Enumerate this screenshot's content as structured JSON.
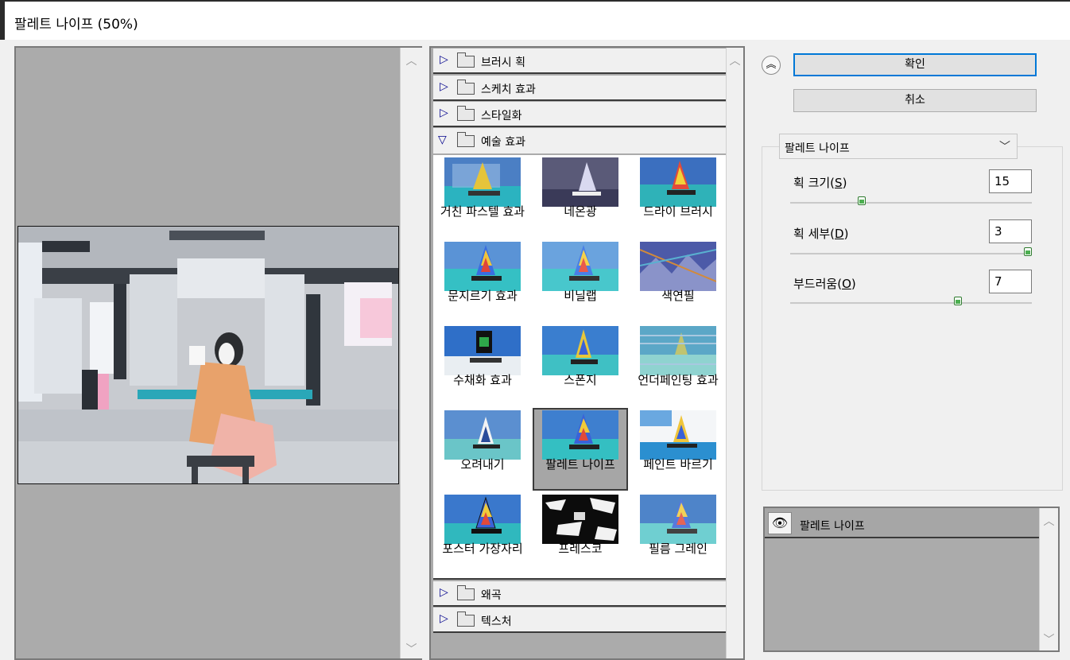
{
  "window": {
    "title": "팔레트 나이프 (50%)"
  },
  "gallery": {
    "groups_top": [
      {
        "label": "브러시 획",
        "expanded": false
      },
      {
        "label": "스케치 효과",
        "expanded": false
      },
      {
        "label": "스타일화",
        "expanded": false
      },
      {
        "label": "예술 효과",
        "expanded": true
      }
    ],
    "filters": [
      {
        "label": "거친 파스텔 효과"
      },
      {
        "label": "네온광"
      },
      {
        "label": "드라이 브러시"
      },
      {
        "label": "문지르기 효과"
      },
      {
        "label": "비닐랩"
      },
      {
        "label": "색연필"
      },
      {
        "label": "수채화 효과"
      },
      {
        "label": "스폰지"
      },
      {
        "label": "언더페인팅 효과"
      },
      {
        "label": "오려내기"
      },
      {
        "label": "팔레트 나이프",
        "selected": true
      },
      {
        "label": "페인트 바르기"
      },
      {
        "label": "포스터 가장자리"
      },
      {
        "label": "프레스코"
      },
      {
        "label": "필름 그레인"
      }
    ],
    "groups_bottom": [
      {
        "label": "왜곡",
        "expanded": false
      },
      {
        "label": "텍스처",
        "expanded": false
      }
    ]
  },
  "buttons": {
    "ok": "확인",
    "cancel": "취소"
  },
  "filter_select": {
    "value": "팔레트 나이프"
  },
  "params": [
    {
      "label": "획 크기(",
      "key": "S",
      "value": "15",
      "level": 0.29
    },
    {
      "label": "획 세부(",
      "key": "D",
      "value": "3",
      "level": 1.0
    },
    {
      "label": "부드러움(",
      "key": "O",
      "value": "7",
      "level": 0.7
    }
  ],
  "layers": {
    "items": [
      {
        "name": "팔레트 나이프"
      }
    ]
  },
  "colors": {
    "accent": "#0078d7",
    "slider_knob": "#4caf50",
    "panel_bg": "#ababab"
  },
  "icons": {
    "expand_collapsed": "triangle-right-icon",
    "expand_open": "triangle-down-icon",
    "folder": "folder-icon",
    "collapse": "double-chevron-up-icon",
    "dropdown": "chevron-down-icon",
    "visibility": "eye-icon"
  }
}
